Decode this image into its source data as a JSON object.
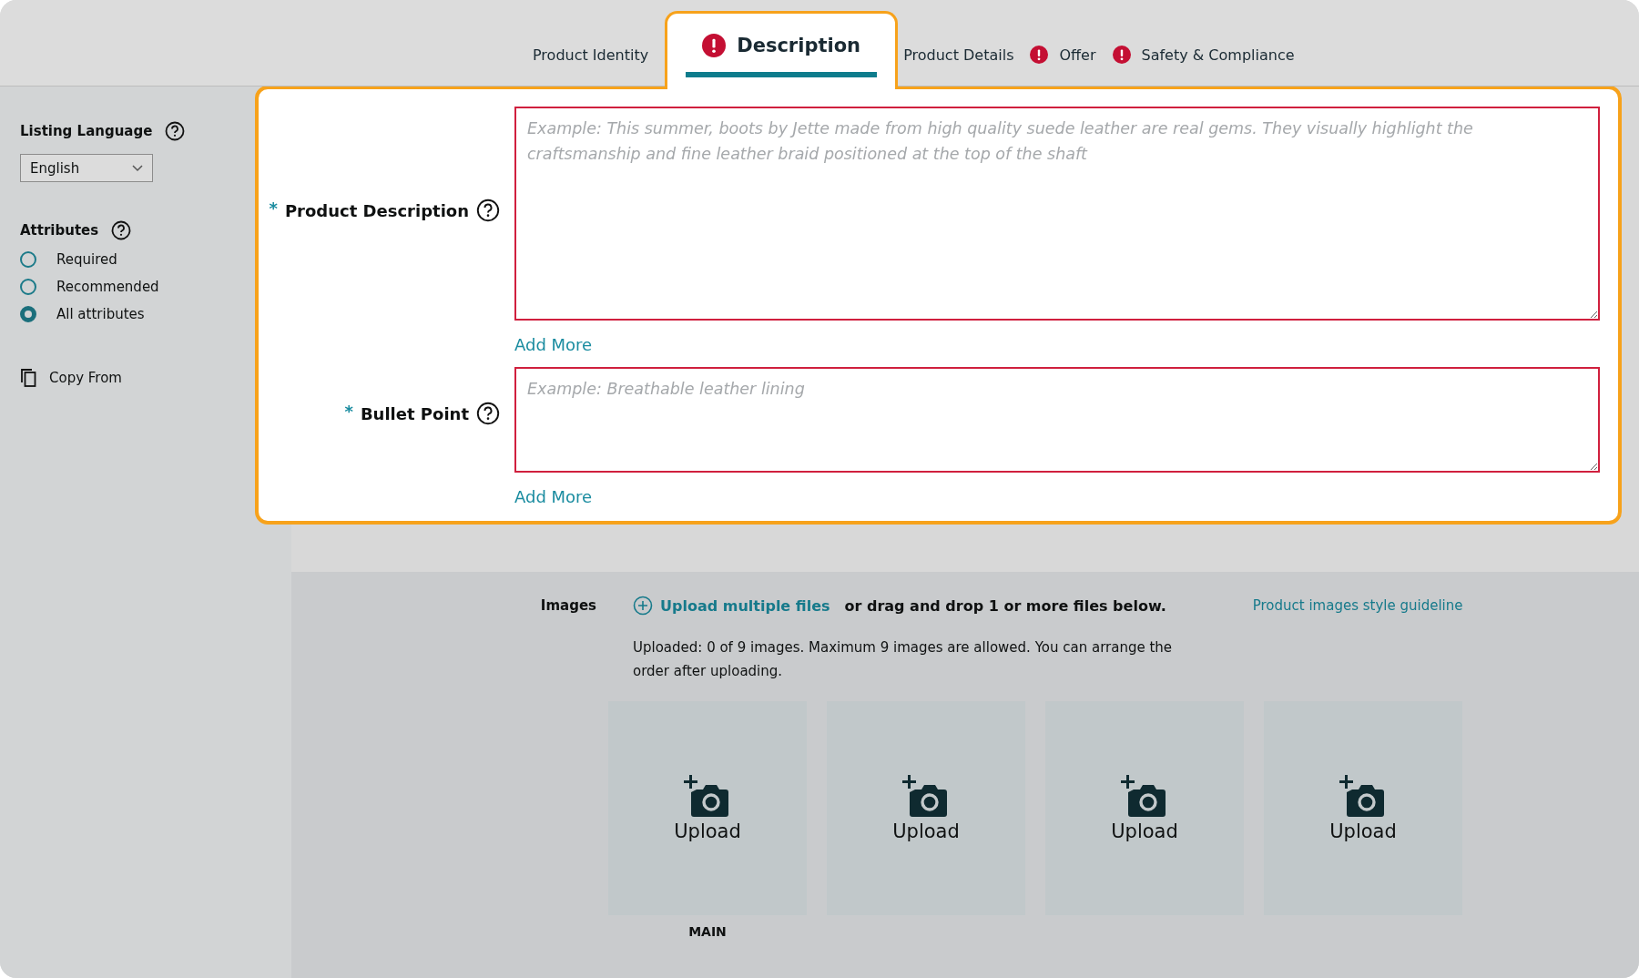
{
  "tabs": [
    {
      "label": "Product Identity",
      "selected": false,
      "error": false
    },
    {
      "label": "Description",
      "selected": true,
      "error": true
    },
    {
      "label": "Product Details",
      "selected": false,
      "error": false
    },
    {
      "label": "Offer",
      "selected": false,
      "error": true
    },
    {
      "label": "Safety & Compliance",
      "selected": false,
      "error": true
    }
  ],
  "sidebar": {
    "listing_language": {
      "label": "Listing Language",
      "value": "English"
    },
    "attributes": {
      "label": "Attributes",
      "options": [
        {
          "label": "Required",
          "selected": false
        },
        {
          "label": "Recommended",
          "selected": false
        },
        {
          "label": "All attributes",
          "selected": true
        }
      ]
    },
    "copy_from": "Copy From"
  },
  "fields": [
    {
      "label": "Product Description",
      "required_mark": "*",
      "error": true,
      "placeholder": "Example: This summer, boots by Jette made from high quality suede leather are real gems. They visually highlight the craftsmanship and fine leather braid positioned at the top of the shaft",
      "kind": "large",
      "add_more": "Add More"
    },
    {
      "label": "Bullet Point",
      "required_mark": "*",
      "error": true,
      "placeholder": "Example: Breathable leather lining",
      "kind": "small",
      "add_more": "Add More"
    }
  ],
  "images": {
    "label": "Images",
    "upload_link": "Upload multiple files",
    "drag_text": "or drag and drop 1 or more files below.",
    "guideline_link": "Product images style guideline",
    "info": "Uploaded: 0 of 9 images. Maximum 9 images are allowed. You can arrange the order after uploading.",
    "tiles": [
      {
        "label": "Upload",
        "caption": "MAIN"
      },
      {
        "label": "Upload"
      },
      {
        "label": "Upload"
      },
      {
        "label": "Upload"
      }
    ]
  }
}
